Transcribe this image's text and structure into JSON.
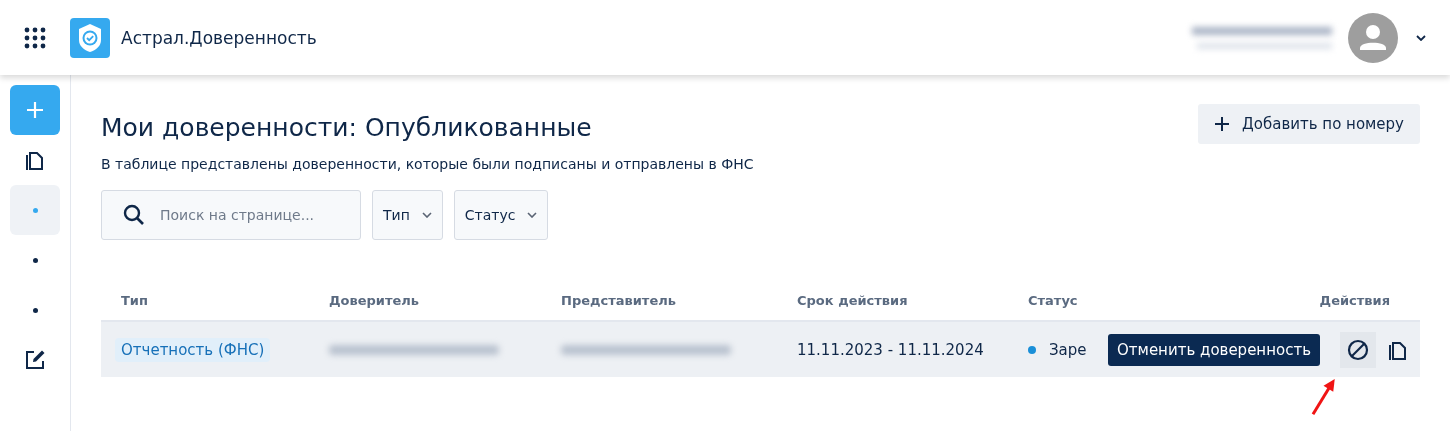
{
  "header": {
    "app_title": "Астрал.Доверенность"
  },
  "sidebar": {
    "items": [
      {
        "kind": "plus",
        "selected": false
      },
      {
        "kind": "copy",
        "selected": false
      },
      {
        "kind": "dot",
        "selected": true
      },
      {
        "kind": "dot",
        "selected": false
      },
      {
        "kind": "dot",
        "selected": false
      },
      {
        "kind": "edit",
        "selected": false
      }
    ]
  },
  "page": {
    "title": "Мои доверенности: Опубликованные",
    "subtitle": "В таблице представлены доверенности, которые были подписаны и отправлены в ФНС",
    "add_button": "Добавить по номеру"
  },
  "filters": {
    "search": {
      "placeholder": "Поиск на странице..."
    },
    "dropdowns": [
      "Тип",
      "Статус"
    ]
  },
  "table": {
    "columns": [
      "Тип",
      "Доверитель",
      "Представитель",
      "Срок действия",
      "Статус",
      "Действия"
    ],
    "rows": [
      {
        "type": "Отчетность (ФНС)",
        "period": "11.11.2023 - 11.11.2024",
        "status": "Заре",
        "color": "#1a8fd8",
        "hovered": true
      }
    ]
  },
  "tooltip": {
    "text": "Отменить доверенность"
  }
}
